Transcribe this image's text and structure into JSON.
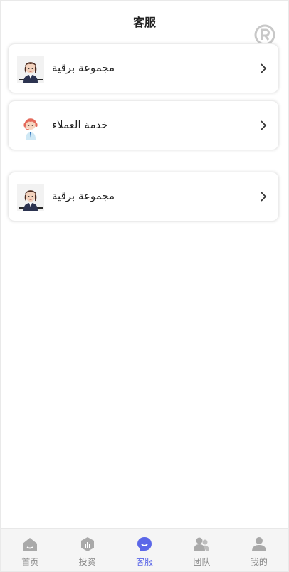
{
  "header": {
    "title": "客服"
  },
  "cards": [
    {
      "label": "مجموعة برقية",
      "avatar": "agent-avatar"
    },
    {
      "label": "خدمة العملاء",
      "avatar": "support-headset-avatar"
    },
    {
      "label": "مجموعة برقية",
      "avatar": "agent-avatar"
    }
  ],
  "tabbar": {
    "items": [
      {
        "label": "首页",
        "icon": "home-icon"
      },
      {
        "label": "投资",
        "icon": "invest-icon"
      },
      {
        "label": "客服",
        "icon": "service-icon",
        "active": true
      },
      {
        "label": "团队",
        "icon": "team-icon"
      },
      {
        "label": "我的",
        "icon": "profile-icon"
      }
    ]
  },
  "colors": {
    "accent": "#5b67e8",
    "tab_inactive": "#8a8a8a",
    "tab_icon_inactive": "#a9a9a9"
  }
}
